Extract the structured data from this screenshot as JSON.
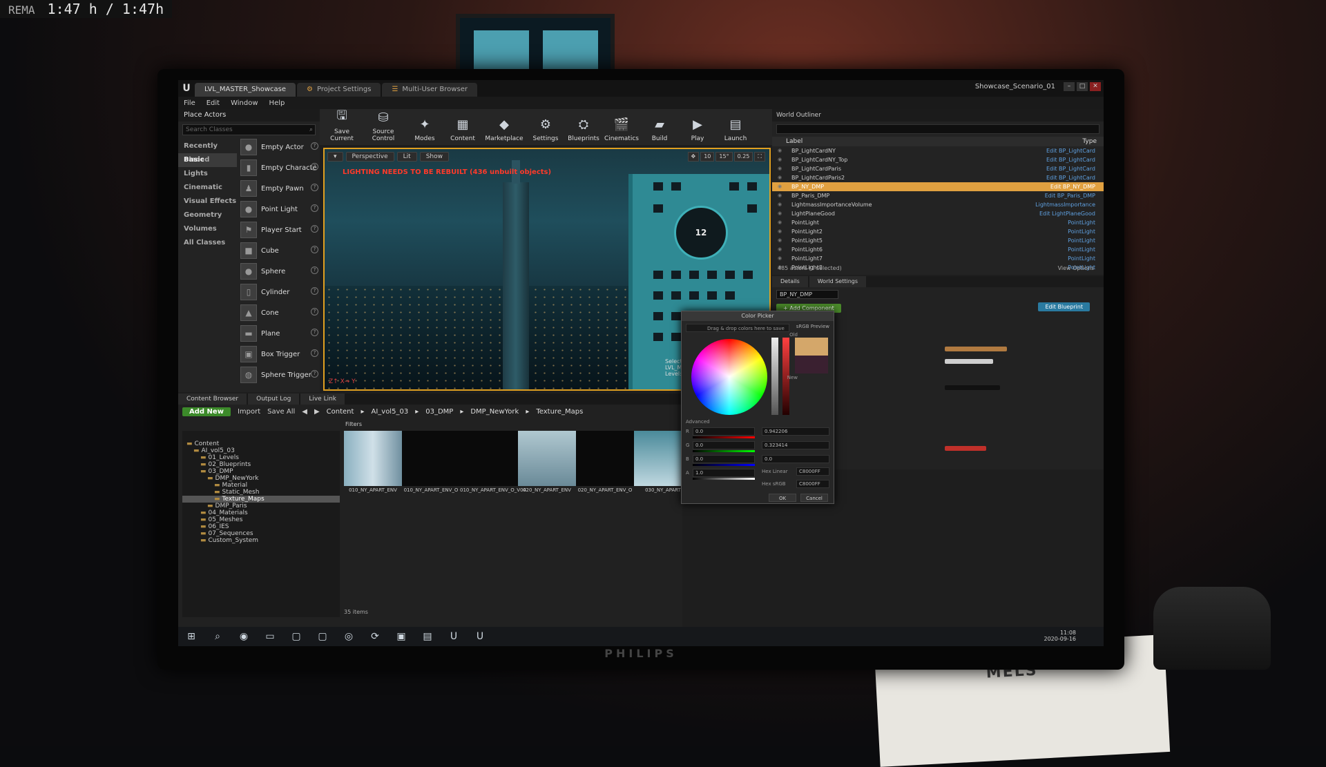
{
  "overlay": {
    "tag": "REMA",
    "time": "1:47 h / 1:47h"
  },
  "monitor": {
    "brand": "PHILIPS"
  },
  "window": {
    "tabs": [
      "LVL_MASTER_Showcase",
      "Project Settings",
      "Multi-User Browser"
    ],
    "project": "Showcase_Scenario_01"
  },
  "menu": [
    "File",
    "Edit",
    "Window",
    "Help"
  ],
  "place_actors": {
    "title": "Place Actors",
    "search_placeholder": "Search Classes",
    "categories": [
      "Recently Placed",
      "Basic",
      "Lights",
      "Cinematic",
      "Visual Effects",
      "Geometry",
      "Volumes",
      "All Classes"
    ],
    "items": [
      "Empty Actor",
      "Empty Characte",
      "Empty Pawn",
      "Point Light",
      "Player Start",
      "Cube",
      "Sphere",
      "Cylinder",
      "Cone",
      "Plane",
      "Box Trigger",
      "Sphere Trigger"
    ]
  },
  "toolbar": [
    "Save Current",
    "Source Control",
    "Modes",
    "Content",
    "Marketplace",
    "Settings",
    "Blueprints",
    "Cinematics",
    "Build",
    "Play",
    "Launch"
  ],
  "viewport": {
    "buttons": [
      "Perspective",
      "Lit",
      "Show"
    ],
    "tools": [
      "10",
      "15°",
      "0.25"
    ],
    "warning": "LIGHTING NEEDS TO BE REBUILT (436 unbuilt objects)",
    "clock": "12",
    "selected": "Selected",
    "level": "LVL_MAS",
    "level2": "Level: L"
  },
  "outliner": {
    "title": "World Outliner",
    "col_label": "Label",
    "col_type": "Type",
    "rows": [
      {
        "label": "BP_LightCardNY",
        "type": "Edit BP_LightCard"
      },
      {
        "label": "BP_LightCardNY_Top",
        "type": "Edit BP_LightCard"
      },
      {
        "label": "BP_LightCardParis",
        "type": "Edit BP_LightCard"
      },
      {
        "label": "BP_LightCardParis2",
        "type": "Edit BP_LightCard"
      },
      {
        "label": "BP_NY_DMP",
        "type": "Edit BP_NY_DMP"
      },
      {
        "label": "BP_Paris_DMP",
        "type": "Edit BP_Paris_DMP"
      },
      {
        "label": "LightmassImportanceVolume",
        "type": "LightmassImportance"
      },
      {
        "label": "LightPlaneGood",
        "type": "Edit LightPlaneGood"
      },
      {
        "label": "PointLight",
        "type": "PointLight"
      },
      {
        "label": "PointLight2",
        "type": "PointLight"
      },
      {
        "label": "PointLight5",
        "type": "PointLight"
      },
      {
        "label": "PointLight6",
        "type": "PointLight"
      },
      {
        "label": "PointLight7",
        "type": "PointLight"
      },
      {
        "label": "PointLight8",
        "type": "PointLight"
      }
    ],
    "count": "485 actors (1 selected)",
    "view_options": "View Options"
  },
  "details": {
    "tabs": [
      "Details",
      "World Settings"
    ],
    "name": "BP_NY_DMP",
    "add_component": "+ Add Component",
    "edit_blueprint": "Edit Blueprint"
  },
  "color_picker": {
    "title": "Color Picker",
    "drag_hint": "Drag & drop colors here to save",
    "srgb": "sRGB Preview",
    "old": "Old",
    "new": "New",
    "advanced": "Advanced",
    "labels": [
      "R",
      "G",
      "B",
      "A"
    ],
    "values": [
      "0.0",
      "0.0",
      "0.0",
      "1.0"
    ],
    "hsv": [
      "0.942206",
      "0.323414",
      "0.0"
    ],
    "hex_linear_label": "Hex Linear",
    "hex_linear": "C8000FF",
    "hex_srgb_label": "Hex sRGB",
    "hex_srgb": "C8000FF",
    "ok": "OK",
    "cancel": "Cancel"
  },
  "content_browser": {
    "tabs": [
      "Content Browser",
      "Output Log",
      "Live Link"
    ],
    "add_new": "Add New",
    "import": "Import",
    "save_all": "Save All",
    "path": [
      "Content",
      "AI_vol5_03",
      "03_DMP",
      "DMP_NewYork",
      "Texture_Maps"
    ],
    "filters": "Filters",
    "tree": [
      "Content",
      "AI_vol5_03",
      "01_Levels",
      "02_Blueprints",
      "03_DMP",
      "DMP_NewYork",
      "Material",
      "Static_Mesh",
      "Texture_Maps",
      "DMP_Paris",
      "04_Materials",
      "05_Meshes",
      "06_IES",
      "07_Sequences",
      "Custom_System"
    ],
    "assets": [
      "010_NY_APART_ENV",
      "010_NY_APART_ENV_O",
      "010_NY_APART_ENV_O_V04",
      "020_NY_APART_ENV",
      "020_NY_APART_ENV_O",
      "030_NY_APART"
    ],
    "count": "35 items"
  },
  "taskbar": {
    "time": "11:08",
    "date": "2020-09-16"
  },
  "desk": {
    "paper_text": "MELS"
  }
}
